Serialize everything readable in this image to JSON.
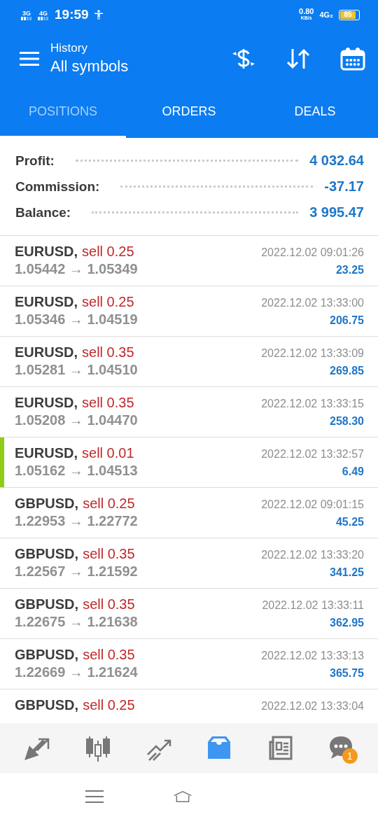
{
  "status_bar": {
    "networks": [
      "3G",
      "4G"
    ],
    "time": "19:59",
    "speed": "0.80",
    "speed_unit": "KB/s",
    "network_right": "4G₂",
    "battery": "85"
  },
  "header": {
    "title": "History",
    "subtitle": "All symbols"
  },
  "tabs": [
    {
      "label": "POSITIONS",
      "selected": true
    },
    {
      "label": "ORDERS",
      "selected": false
    },
    {
      "label": "DEALS",
      "selected": false
    }
  ],
  "summary": [
    {
      "label": "Profit:",
      "value": "4 032.64"
    },
    {
      "label": "Commission:",
      "value": "-37.17"
    },
    {
      "label": "Balance:",
      "value": "3 995.47"
    }
  ],
  "positions": [
    {
      "symbol": "EURUSD,",
      "side": "sell 0.25",
      "prices": "1.05442 → 1.05349",
      "time": "2022.12.02 09:01:26",
      "profit": "23.25",
      "selected": false
    },
    {
      "symbol": "EURUSD,",
      "side": "sell 0.25",
      "prices": "1.05346 → 1.04519",
      "time": "2022.12.02 13:33:00",
      "profit": "206.75",
      "selected": false
    },
    {
      "symbol": "EURUSD,",
      "side": "sell 0.35",
      "prices": "1.05281 → 1.04510",
      "time": "2022.12.02 13:33:09",
      "profit": "269.85",
      "selected": false
    },
    {
      "symbol": "EURUSD,",
      "side": "sell 0.35",
      "prices": "1.05208 → 1.04470",
      "time": "2022.12.02 13:33:15",
      "profit": "258.30",
      "selected": false
    },
    {
      "symbol": "EURUSD,",
      "side": "sell 0.01",
      "prices": "1.05162 → 1.04513",
      "time": "2022.12.02 13:32:57",
      "profit": "6.49",
      "selected": true
    },
    {
      "symbol": "GBPUSD,",
      "side": "sell 0.25",
      "prices": "1.22953 → 1.22772",
      "time": "2022.12.02 09:01:15",
      "profit": "45.25",
      "selected": false
    },
    {
      "symbol": "GBPUSD,",
      "side": "sell 0.35",
      "prices": "1.22567 → 1.21592",
      "time": "2022.12.02 13:33:20",
      "profit": "341.25",
      "selected": false
    },
    {
      "symbol": "GBPUSD,",
      "side": "sell 0.35",
      "prices": "1.22675 → 1.21638",
      "time": "2022.12.02 13:33:11",
      "profit": "362.95",
      "selected": false
    },
    {
      "symbol": "GBPUSD,",
      "side": "sell 0.35",
      "prices": "1.22669 → 1.21624",
      "time": "2022.12.02 13:33:13",
      "profit": "365.75",
      "selected": false
    },
    {
      "symbol": "GBPUSD,",
      "side": "sell 0.25",
      "time": "2022.12.02 13:33:04",
      "selected": false
    }
  ],
  "bottom_nav": [
    {
      "kind": "trade",
      "selected": false
    },
    {
      "kind": "chart",
      "selected": false
    },
    {
      "kind": "trend",
      "selected": false
    },
    {
      "kind": "history",
      "selected": true
    },
    {
      "kind": "news",
      "selected": false
    },
    {
      "kind": "chat",
      "selected": false,
      "badge": "1"
    }
  ]
}
